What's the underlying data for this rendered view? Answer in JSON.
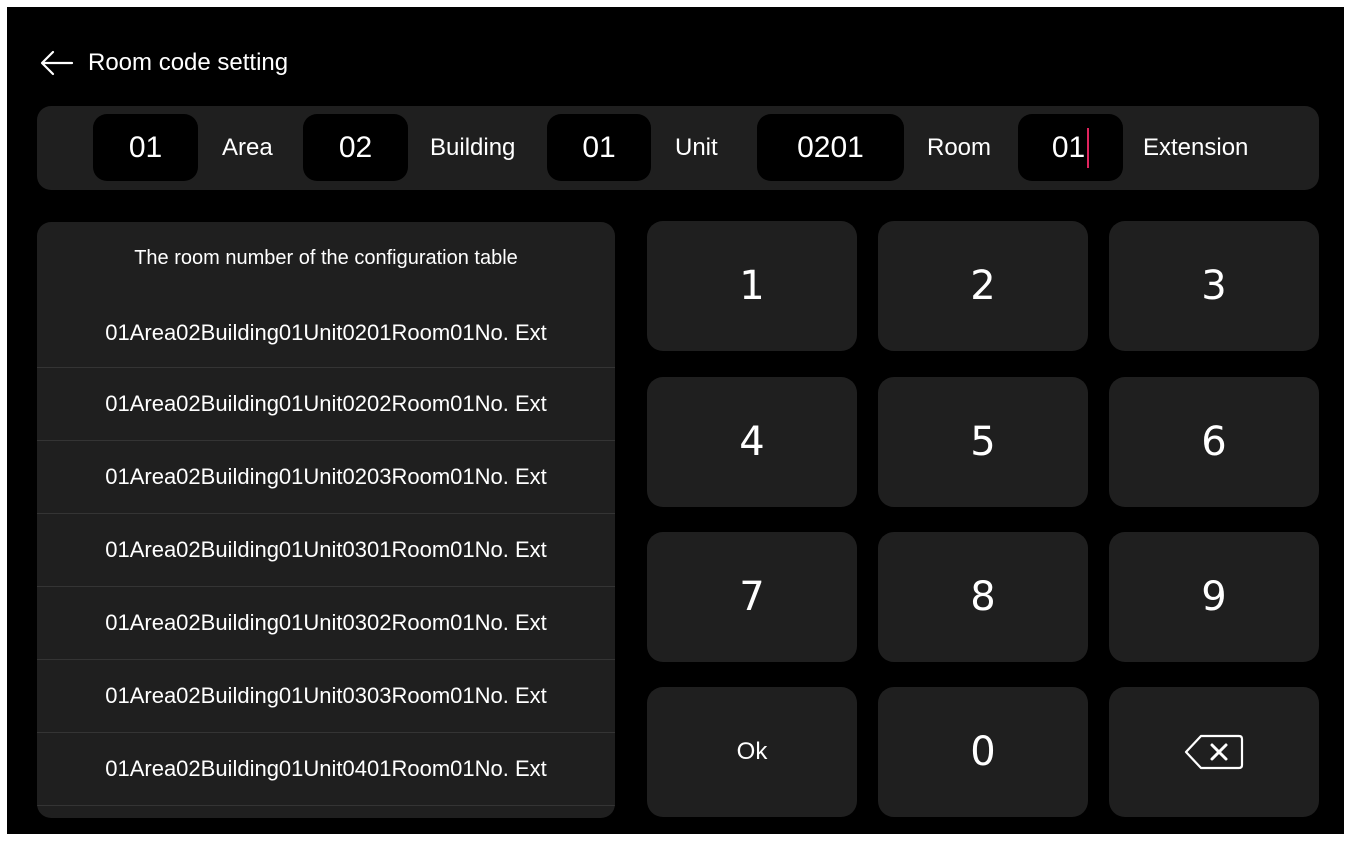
{
  "header": {
    "title": "Room code setting"
  },
  "code_bar": {
    "area_value": "01",
    "area_label": "Area",
    "building_value": "02",
    "building_label": "Building",
    "unit_value": "01",
    "unit_label": "Unit",
    "room_value": "0201",
    "room_label": "Room",
    "extension_value": "01",
    "extension_label": "Extension",
    "cursor_color": "#e0245e"
  },
  "table": {
    "title": "The room number of the configuration table",
    "rows": [
      "01Area02Building01Unit0201Room01No. Ext",
      "01Area02Building01Unit0202Room01No. Ext",
      "01Area02Building01Unit0203Room01No. Ext",
      "01Area02Building01Unit0301Room01No. Ext",
      "01Area02Building01Unit0302Room01No. Ext",
      "01Area02Building01Unit0303Room01No. Ext",
      "01Area02Building01Unit0401Room01No. Ext"
    ]
  },
  "keypad": {
    "k1": "1",
    "k2": "2",
    "k3": "3",
    "k4": "4",
    "k5": "5",
    "k6": "6",
    "k7": "7",
    "k8": "8",
    "k9": "9",
    "ok": "Ok",
    "k0": "0",
    "backspace_icon": "backspace-icon"
  },
  "colors": {
    "background": "#000000",
    "panel": "#1f1f1f",
    "text": "#ffffff"
  }
}
